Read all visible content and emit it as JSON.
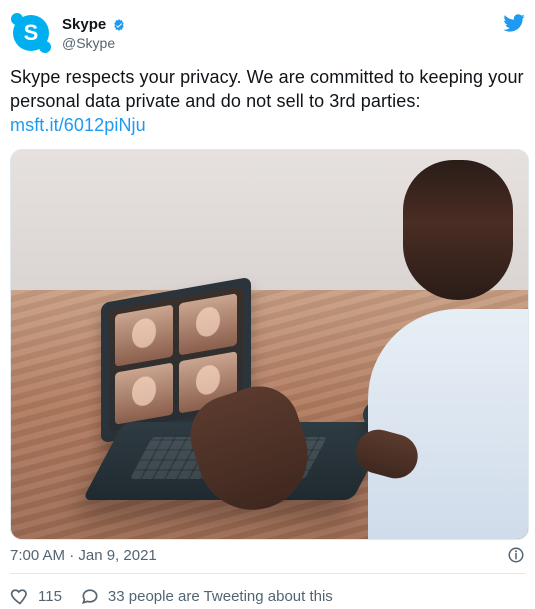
{
  "tweet": {
    "author": {
      "name": "Skype",
      "handle": "@Skype"
    },
    "text_before_link": "Skype respects your privacy. We are committed to keeping your personal data private and do not sell to 3rd parties: ",
    "link_text": "msft.it/6012piNju",
    "timestamp": "7:00 AM · Jan 9, 2021",
    "likes": "115",
    "tweeting_text": "33 people are Tweeting about this"
  },
  "colors": {
    "skype_blue": "#00aff0",
    "twitter_blue": "#1d9bf0",
    "muted_text": "#536471"
  },
  "icons": {
    "twitter_bird": "twitter-bird-icon",
    "verified": "verified-badge-icon",
    "info": "info-icon",
    "like": "heart-icon",
    "reply": "speech-bubble-icon"
  }
}
